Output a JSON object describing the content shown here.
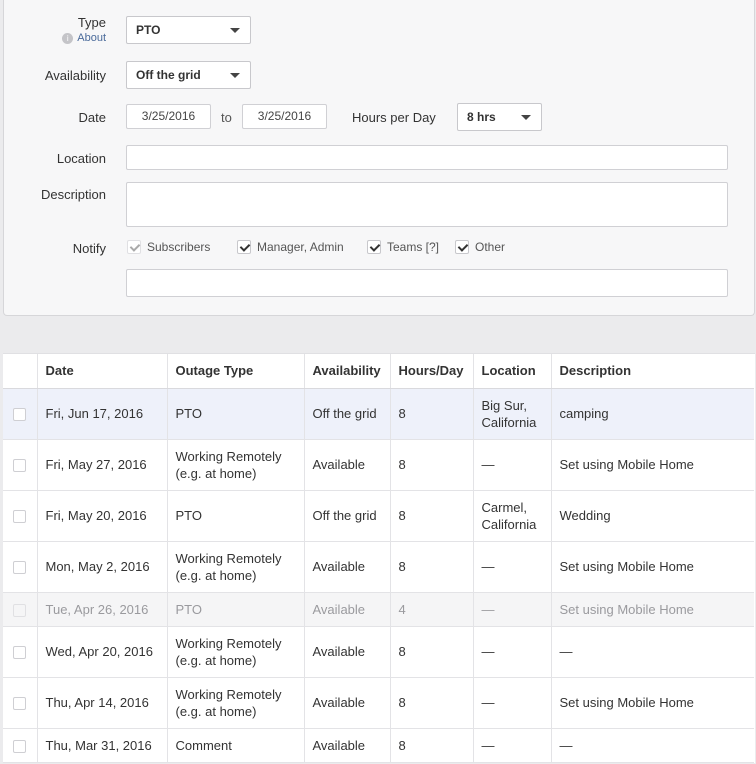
{
  "form": {
    "type_label": "Type",
    "about_label": "About",
    "type_value": "PTO",
    "availability_label": "Availability",
    "availability_value": "Off the grid",
    "date_label": "Date",
    "date_from": "3/25/2016",
    "date_to_label": "to",
    "date_to": "3/25/2016",
    "hours_label": "Hours per Day",
    "hours_value": "8 hrs",
    "location_label": "Location",
    "location_value": "",
    "description_label": "Description",
    "description_value": "",
    "notify_label": "Notify",
    "notify_options": [
      {
        "label": "Subscribers",
        "checked": true,
        "disabled": true
      },
      {
        "label": "Manager, Admin",
        "checked": true,
        "disabled": false
      },
      {
        "label": "Teams [?]",
        "checked": true,
        "disabled": false
      },
      {
        "label": "Other",
        "checked": true,
        "disabled": false
      }
    ],
    "notify_other_value": ""
  },
  "table": {
    "headers": [
      "Date",
      "Outage Type",
      "Availability",
      "Hours/Day",
      "Location",
      "Description"
    ],
    "rows": [
      {
        "date": "Fri, Jun 17, 2016",
        "type": "PTO",
        "availability": "Off the grid",
        "hours": "8",
        "location": "Big Sur, California",
        "description": "camping",
        "state": "highlight"
      },
      {
        "date": "Fri, May 27, 2016",
        "type": "Working Remotely (e.g. at home)",
        "availability": "Available",
        "hours": "8",
        "location": "—",
        "description": "Set using Mobile Home",
        "state": "normal"
      },
      {
        "date": "Fri, May 20, 2016",
        "type": "PTO",
        "availability": "Off the grid",
        "hours": "8",
        "location": "Carmel, California",
        "description": "Wedding",
        "state": "normal"
      },
      {
        "date": "Mon, May 2, 2016",
        "type": "Working Remotely (e.g. at home)",
        "availability": "Available",
        "hours": "8",
        "location": "—",
        "description": "Set using Mobile Home",
        "state": "normal"
      },
      {
        "date": "Tue, Apr 26, 2016",
        "type": "PTO",
        "availability": "Available",
        "hours": "4",
        "location": "—",
        "description": "Set using Mobile Home",
        "state": "muted"
      },
      {
        "date": "Wed, Apr 20, 2016",
        "type": "Working Remotely (e.g. at home)",
        "availability": "Available",
        "hours": "8",
        "location": "—",
        "description": "—",
        "state": "normal"
      },
      {
        "date": "Thu, Apr 14, 2016",
        "type": "Working Remotely (e.g. at home)",
        "availability": "Available",
        "hours": "8",
        "location": "—",
        "description": "Set using Mobile Home",
        "state": "normal"
      },
      {
        "date": "Thu, Mar 31, 2016",
        "type": "Comment",
        "availability": "Available",
        "hours": "8",
        "location": "—",
        "description": "—",
        "state": "short"
      }
    ]
  }
}
